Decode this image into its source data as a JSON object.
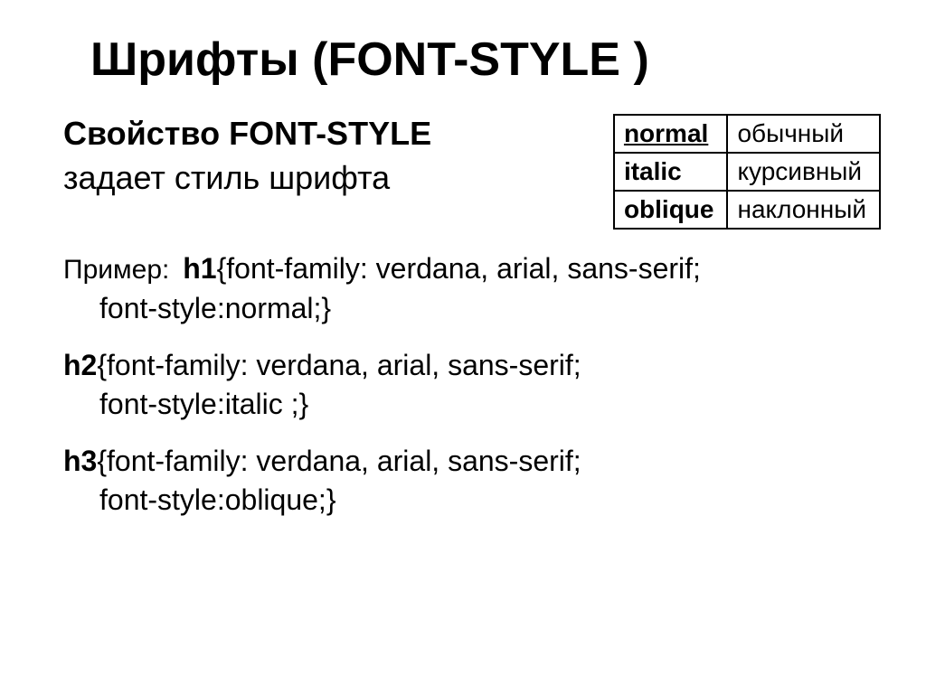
{
  "title": "Шрифты (FONT-STYLE )",
  "intro_property_prefix": "Свойство ",
  "intro_property_name": "FONT-STYLE",
  "intro_desc": "задает стиль шрифта",
  "table": {
    "rows": [
      {
        "key": "normal",
        "value": "обычный",
        "underline": true
      },
      {
        "key": "italic",
        "value": "курсивный",
        "underline": false
      },
      {
        "key": "oblique",
        "value": "наклонный",
        "underline": false
      }
    ]
  },
  "example_label": "Пример:",
  "examples": {
    "e1_sel": "h1",
    "e1_body_line1": "{font-family: verdana, arial, sans-serif;",
    "e1_body_line2": "font-style:normal;}",
    "e2_sel": "h2",
    "e2_body_line1": "{font-family: verdana, arial, sans-serif;",
    "e2_body_line2": "font-style:italic ;}",
    "e3_sel": "h3",
    "e3_body_line1": "{font-family: verdana, arial, sans-serif;",
    "e3_body_line2": "font-style:oblique;}"
  }
}
